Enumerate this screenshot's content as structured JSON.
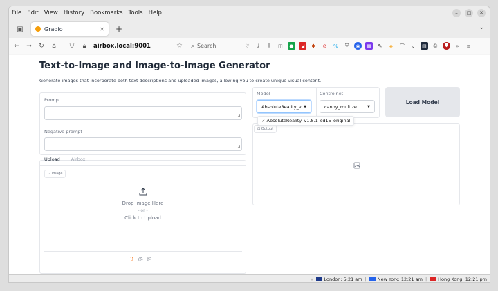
{
  "menubar": {
    "items": [
      "File",
      "Edit",
      "View",
      "History",
      "Bookmarks",
      "Tools",
      "Help"
    ]
  },
  "browser": {
    "tab_title": "Gradio",
    "url": "airbox.local:9001",
    "search_placeholder": "Search"
  },
  "page": {
    "title": "Text-to-Image and Image-to-Image Generator",
    "description": "Generate images that incorporate both text descriptions and uploaded images, allowing you to create unique visual content."
  },
  "prompt": {
    "label": "Prompt",
    "value": ""
  },
  "negative_prompt": {
    "label": "Negative prompt",
    "value": ""
  },
  "upload_tabs": [
    "Upload",
    "Airbox"
  ],
  "image_input": {
    "chip": "Image",
    "drop_text": "Drop Image Here",
    "or_text": "- or -",
    "click_text": "Click to Upload"
  },
  "model": {
    "label": "Model",
    "selected": "AbsoluteReality_v",
    "dropdown_option": "AbsoluteReality_v1.8.1_sd15_original"
  },
  "controlnet": {
    "label": "Controlnet",
    "selected": "canny_multize"
  },
  "load_button": "Load Model",
  "output": {
    "chip": "Output"
  },
  "statusbar": {
    "clocks": [
      {
        "label": "London: 5:21 am",
        "flag_color": "#1e3a8a"
      },
      {
        "label": "New York: 12:21 am",
        "flag_color": "#2563eb"
      },
      {
        "label": "Hong Kong: 12:21 pm",
        "flag_color": "#dc2626"
      }
    ]
  },
  "colors": {
    "accent": "#f97316",
    "focus": "#93c5fd"
  }
}
